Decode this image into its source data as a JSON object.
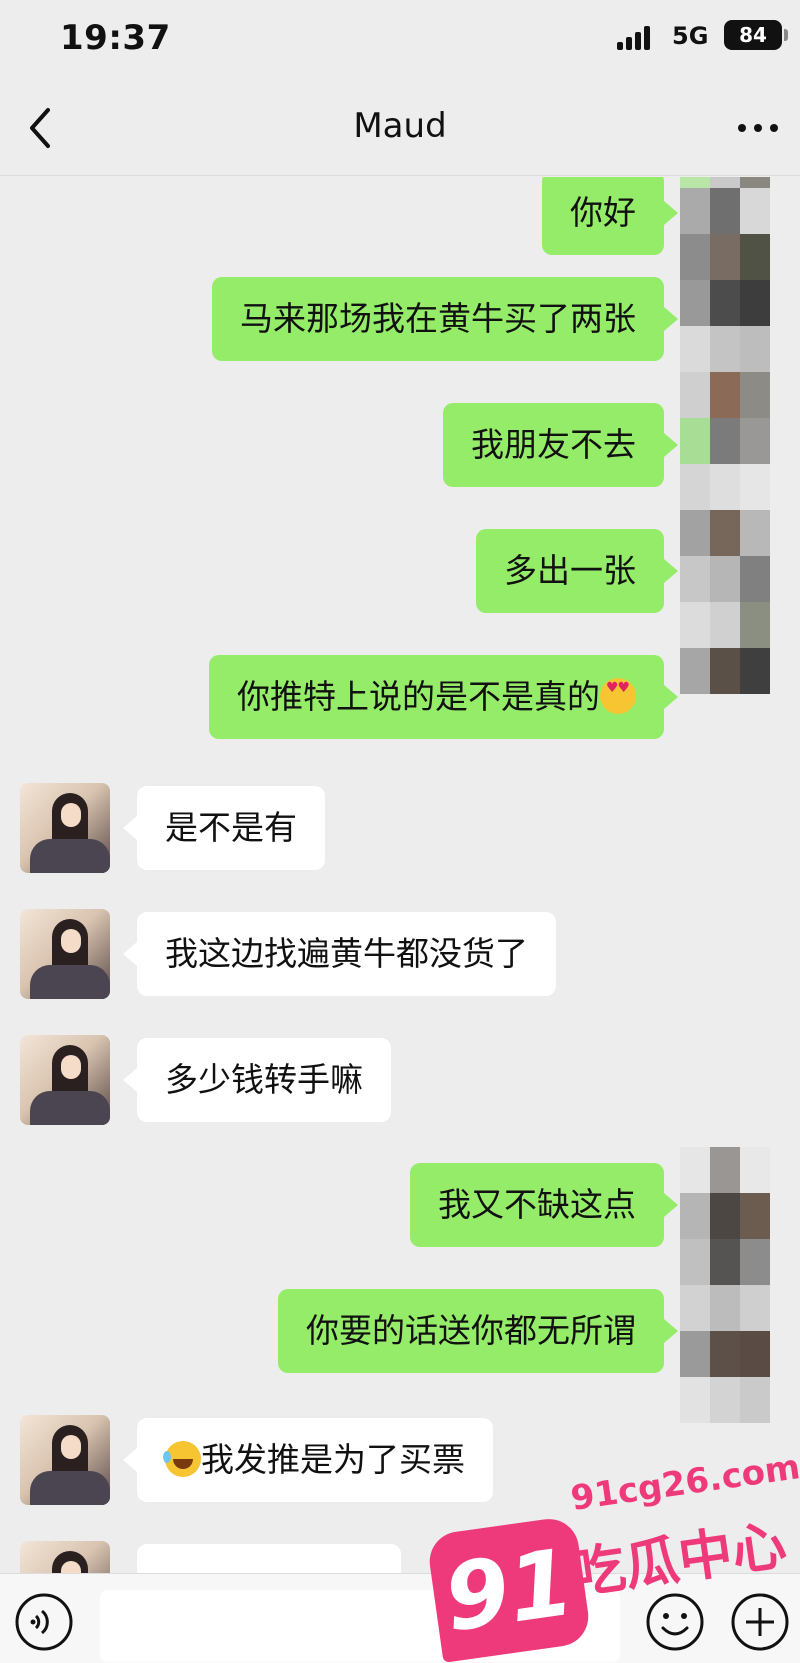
{
  "status_bar": {
    "time": "19:37",
    "network": "5G",
    "battery": "84"
  },
  "header": {
    "title": "Maud"
  },
  "messages": [
    {
      "side": "sent",
      "text": "你好"
    },
    {
      "side": "sent",
      "text": "马来那场我在黄牛买了两张"
    },
    {
      "side": "sent",
      "text": "我朋友不去"
    },
    {
      "side": "sent",
      "text": "多出一张"
    },
    {
      "side": "sent",
      "text": "你推特上说的是不是真的",
      "emoji": "heart-eyes-emoji"
    },
    {
      "side": "received",
      "text": "是不是有"
    },
    {
      "side": "received",
      "text": "我这边找遍黄牛都没货了"
    },
    {
      "side": "received",
      "text": "多少钱转手嘛"
    },
    {
      "side": "sent",
      "text": "我又不缺这点"
    },
    {
      "side": "sent",
      "text": "你要的话送你都无所谓"
    },
    {
      "side": "received",
      "text": "我发推是为了买票",
      "emoji": "tears-of-joy-emoji"
    }
  ],
  "watermark": {
    "number": "91",
    "url": "91cg26.com",
    "name": "吃瓜中心"
  },
  "icons": [
    "back-arrow-icon",
    "more-dots-icon",
    "voice-icon",
    "emoji-icon",
    "plus-icon"
  ]
}
